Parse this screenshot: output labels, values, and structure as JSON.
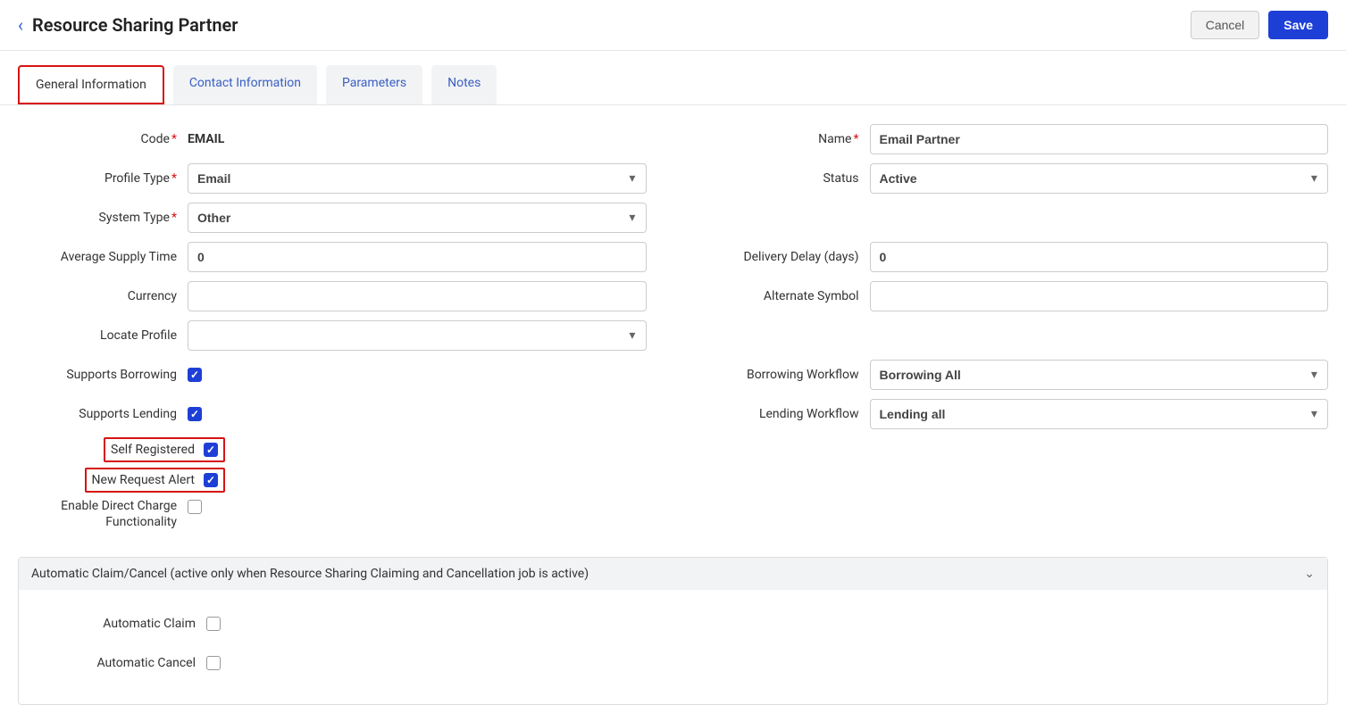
{
  "header": {
    "title": "Resource Sharing Partner",
    "cancel_label": "Cancel",
    "save_label": "Save"
  },
  "tabs": [
    {
      "label": "General Information",
      "active": true
    },
    {
      "label": "Contact Information",
      "active": false
    },
    {
      "label": "Parameters",
      "active": false
    },
    {
      "label": "Notes",
      "active": false
    }
  ],
  "labels": {
    "code": "Code",
    "name": "Name",
    "profile_type": "Profile Type",
    "status": "Status",
    "system_type": "System Type",
    "avg_supply_time": "Average Supply Time",
    "delivery_delay": "Delivery Delay (days)",
    "currency": "Currency",
    "alternate_symbol": "Alternate Symbol",
    "locate_profile": "Locate Profile",
    "supports_borrowing": "Supports Borrowing",
    "borrowing_workflow": "Borrowing Workflow",
    "supports_lending": "Supports Lending",
    "lending_workflow": "Lending Workflow",
    "self_registered": "Self Registered",
    "new_request_alert": "New Request Alert",
    "enable_direct_charge": "Enable Direct Charge Functionality",
    "automatic_claim": "Automatic Claim",
    "automatic_cancel": "Automatic Cancel"
  },
  "values": {
    "code": "EMAIL",
    "name": "Email Partner",
    "profile_type": "Email",
    "status": "Active",
    "system_type": "Other",
    "avg_supply_time": "0",
    "delivery_delay": "0",
    "currency": "",
    "alternate_symbol": "",
    "locate_profile": "",
    "supports_borrowing": true,
    "borrowing_workflow": "Borrowing All",
    "supports_lending": true,
    "lending_workflow": "Lending all",
    "self_registered": true,
    "new_request_alert": true,
    "enable_direct_charge": false,
    "automatic_claim": false,
    "automatic_cancel": false
  },
  "collapsible": {
    "title": "Automatic Claim/Cancel (active only when Resource Sharing Claiming and Cancellation job is active)"
  }
}
